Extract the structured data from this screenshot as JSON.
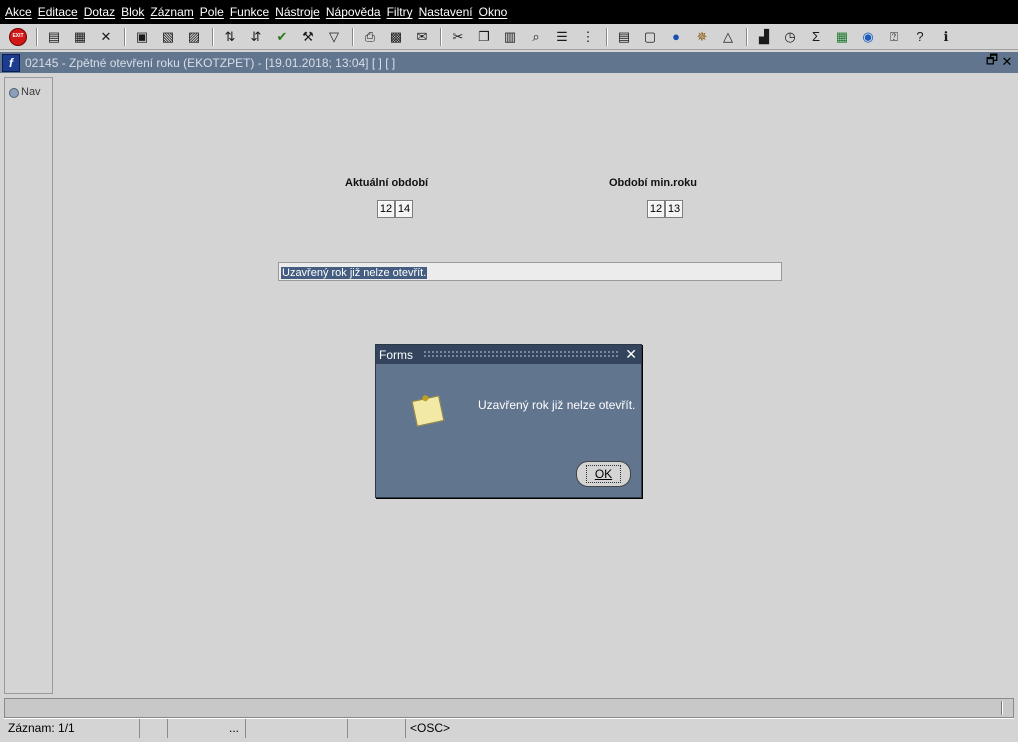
{
  "menu": {
    "items": [
      "Akce",
      "Editace",
      "Dotaz",
      "Blok",
      "Záznam",
      "Pole",
      "Funkce",
      "Nástroje",
      "Nápověda",
      "Filtry",
      "Nastavení",
      "Okno"
    ]
  },
  "toolbar": {
    "exit_label": "EXIT"
  },
  "window": {
    "title": "02145 - Zpětné otevření roku (EKOTZPET) - [19.01.2018; 13:04]  [ ]  [ ]"
  },
  "nav": {
    "label": "Nav"
  },
  "form": {
    "current_period_label": "Aktuální období",
    "current_period_values": [
      "12",
      "14"
    ],
    "prev_period_label": "Období min.roku",
    "prev_period_values": [
      "12",
      "13"
    ],
    "message_value": "Uzavřený rok již nelze otevřít."
  },
  "dialog": {
    "title": "Forms",
    "message": "Uzavřený rok již nelze otevřít.",
    "ok_label": "OK"
  },
  "status": {
    "record": "Záznam: 1/1",
    "ellipsis": "...",
    "mode": "<OSC>"
  },
  "colors": {
    "menubar": "#000000",
    "titlebar": "#62758e",
    "dialog_bg": "#62758e",
    "dialog_titlebar": "#33445c",
    "selection": "#445d80"
  }
}
